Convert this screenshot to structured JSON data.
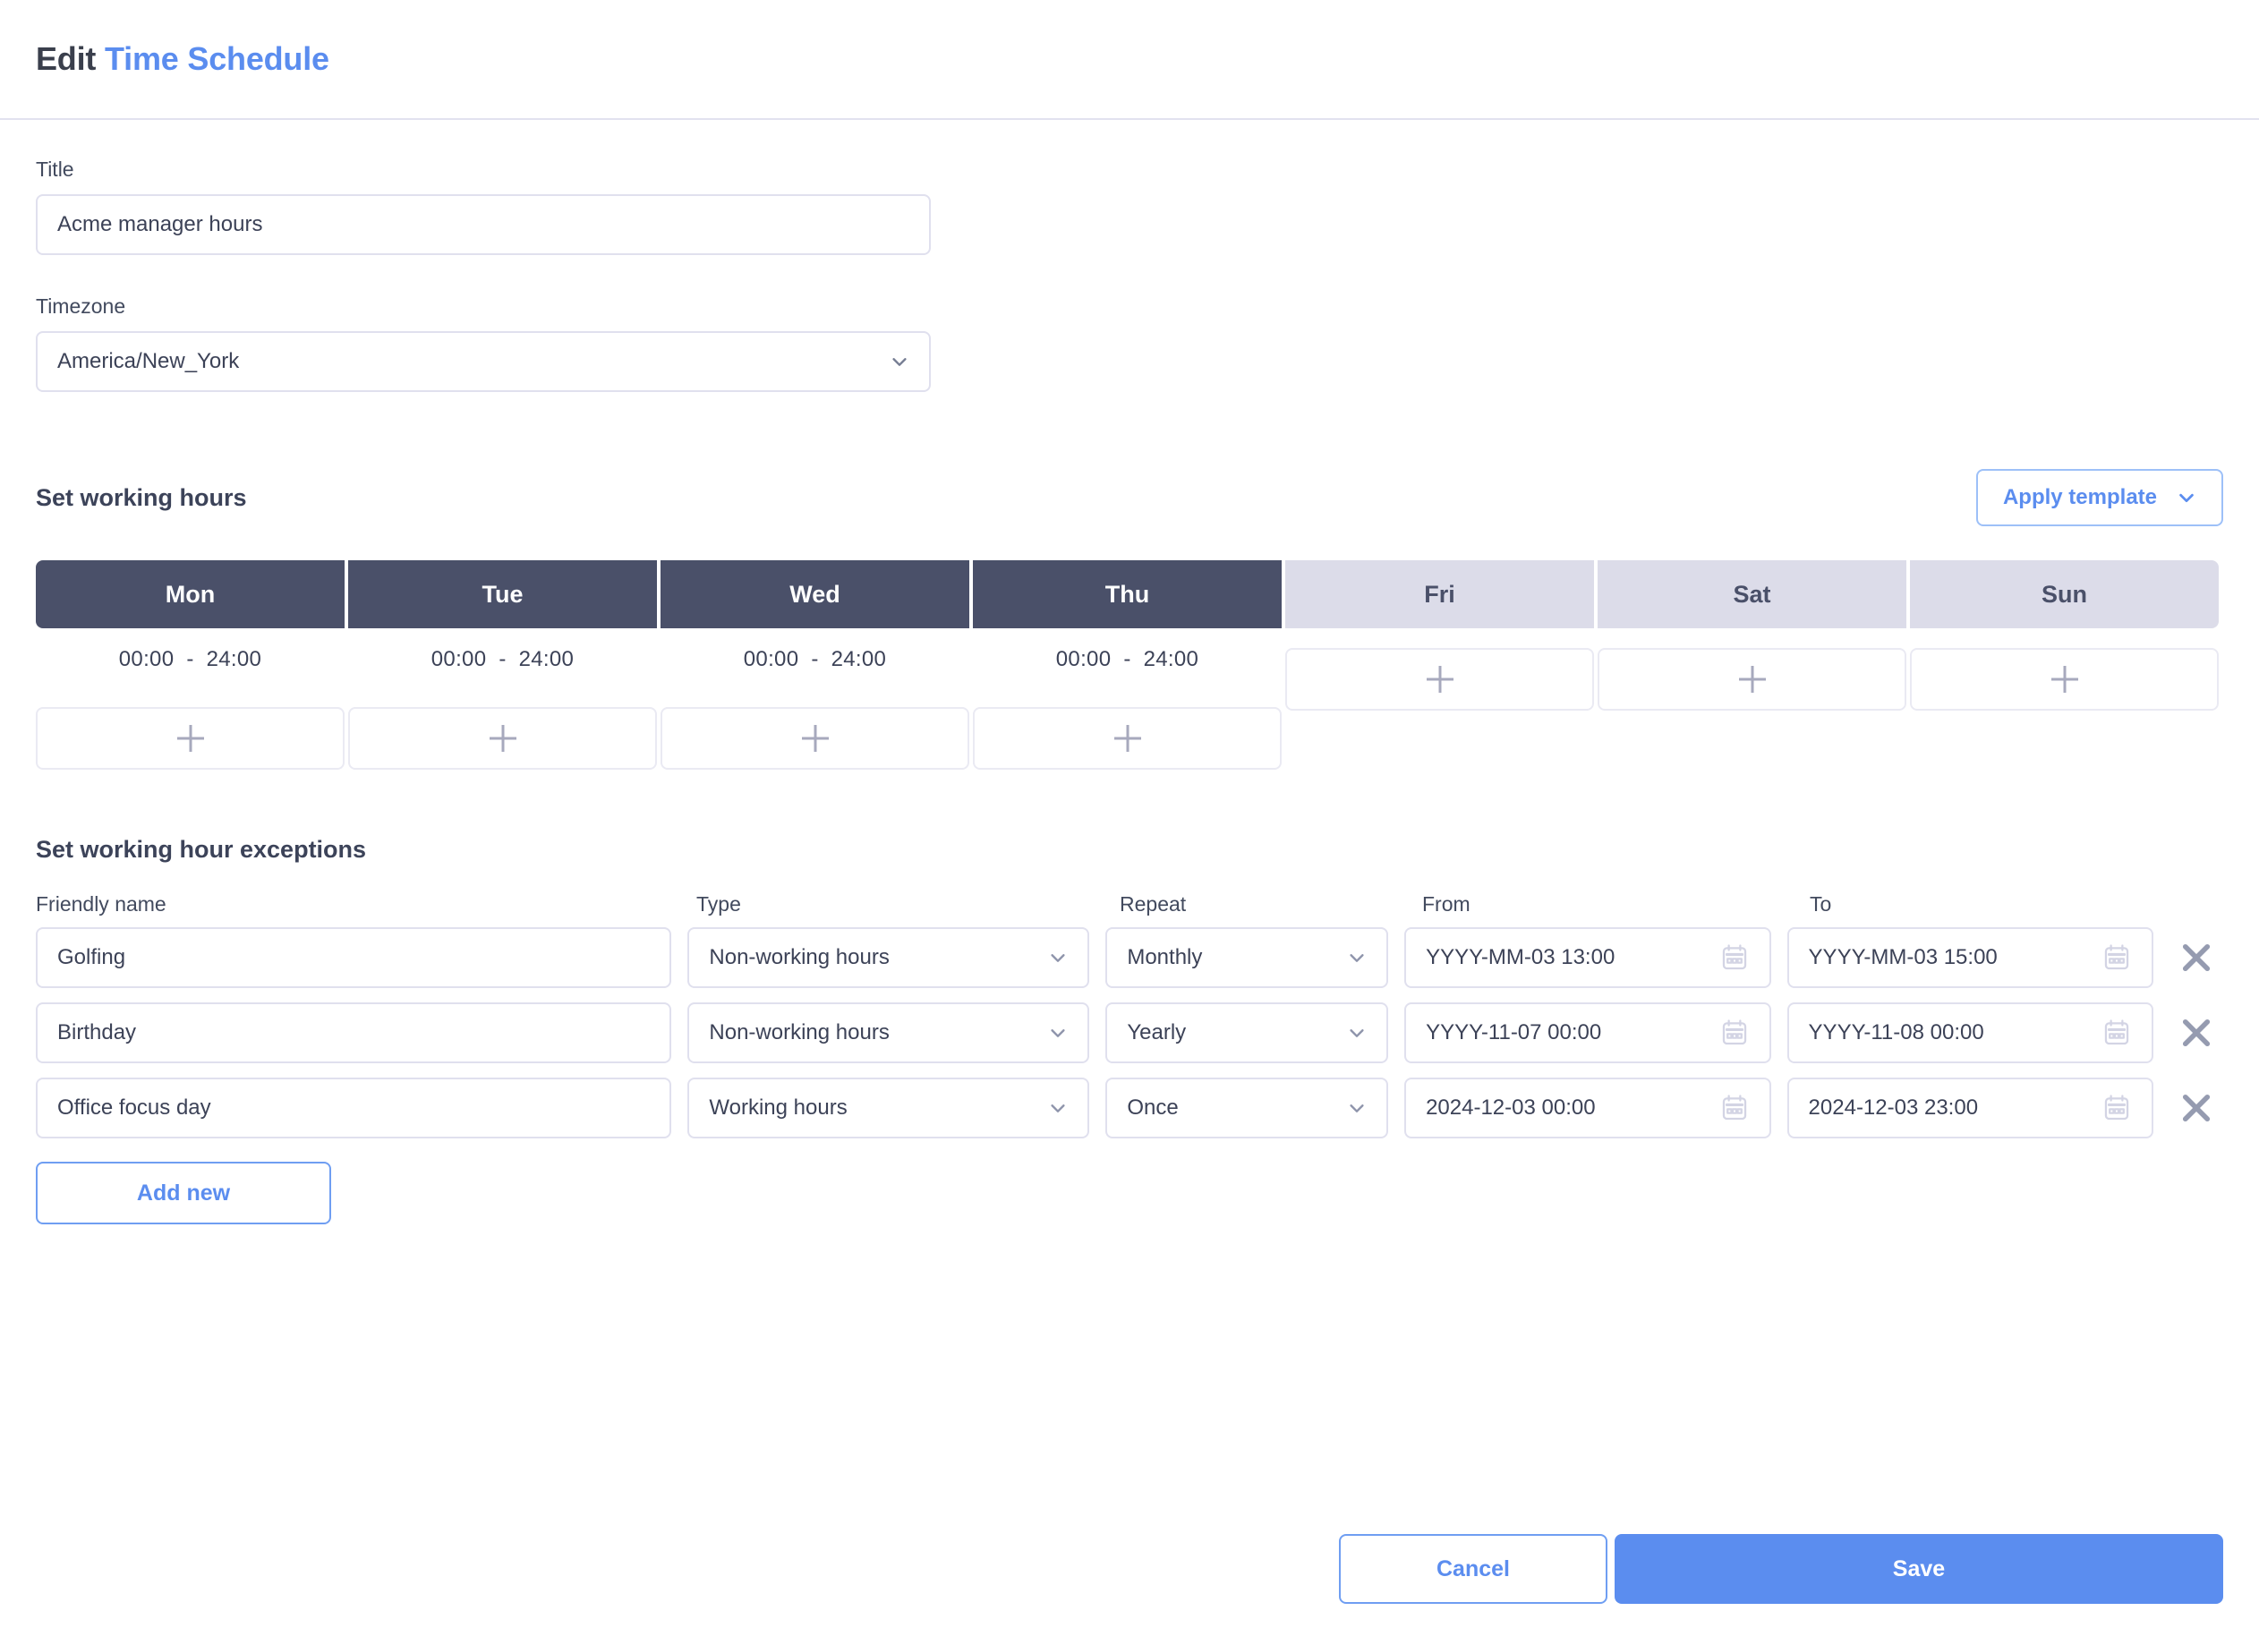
{
  "header": {
    "title_prefix": "Edit",
    "title_accent": "Time Schedule"
  },
  "form": {
    "title_label": "Title",
    "title_value": "Acme manager hours",
    "title_placeholder": "Title",
    "timezone_label": "Timezone",
    "timezone_value": "America/New_York"
  },
  "working_hours": {
    "heading": "Set working hours",
    "apply_template_label": "Apply template",
    "days": [
      {
        "name": "Mon",
        "enabled": true,
        "range": {
          "from": "00:00",
          "dash": "-",
          "to": "24:00"
        }
      },
      {
        "name": "Tue",
        "enabled": true,
        "range": {
          "from": "00:00",
          "dash": "-",
          "to": "24:00"
        }
      },
      {
        "name": "Wed",
        "enabled": true,
        "range": {
          "from": "00:00",
          "dash": "-",
          "to": "24:00"
        }
      },
      {
        "name": "Thu",
        "enabled": true,
        "range": {
          "from": "00:00",
          "dash": "-",
          "to": "24:00"
        }
      },
      {
        "name": "Fri",
        "enabled": false,
        "range": null
      },
      {
        "name": "Sat",
        "enabled": false,
        "range": null
      },
      {
        "name": "Sun",
        "enabled": false,
        "range": null
      }
    ],
    "add_icon": "plus-icon"
  },
  "exceptions": {
    "heading": "Set working hour exceptions",
    "columns": [
      "Friendly name",
      "Type",
      "Repeat",
      "From",
      "To"
    ],
    "rows": [
      {
        "name": "Golfing",
        "type": "Non-working hours",
        "repeat": "Monthly",
        "from": "YYYY-MM-03 13:00",
        "to": "YYYY-MM-03 15:00"
      },
      {
        "name": "Birthday",
        "type": "Non-working hours",
        "repeat": "Yearly",
        "from": "YYYY-11-07 00:00",
        "to": "YYYY-11-08 00:00"
      },
      {
        "name": "Office focus day",
        "type": "Working hours",
        "repeat": "Once",
        "from": "2024-12-03 00:00",
        "to": "2024-12-03 23:00"
      }
    ],
    "add_new_label": "Add new",
    "delete_icon": "close-x-icon",
    "calendar_icon": "calendar-icon"
  },
  "footer": {
    "cancel_label": "Cancel",
    "save_label": "Save"
  },
  "colors": {
    "accent_blue": "#5b8def",
    "day_active": "#4a5069",
    "day_inactive": "#dcdce9",
    "border": "#e0e0ee",
    "text": "#3c4257",
    "icon_muted": "#a7a9bd"
  }
}
